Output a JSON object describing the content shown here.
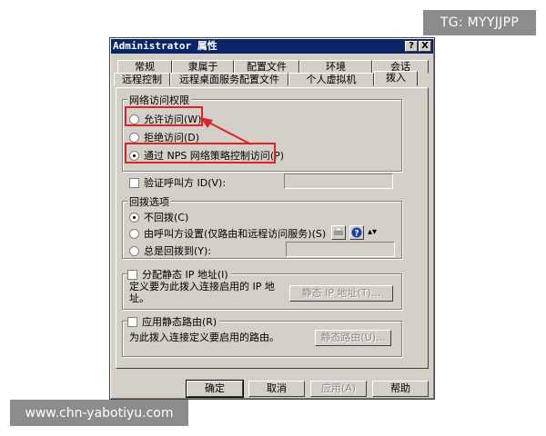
{
  "watermark_top": "TG: MYYJJPP",
  "watermark_bottom": "www.chn-yabotiyu.com",
  "window": {
    "title": "Administrator 属性",
    "help_btn": "?",
    "close_btn": "X"
  },
  "tabs_row1": [
    "常规",
    "隶属于",
    "配置文件",
    "环境",
    "会话"
  ],
  "tabs_row2": [
    "远程控制",
    "远程桌面服务配置文件",
    "个人虚拟机",
    "拨入"
  ],
  "access": {
    "legend": "网络访问权限",
    "allow": "允许访问(W)",
    "deny": "拒绝访问(D)",
    "nps": "通过 NPS 网络策略控制访问(P)"
  },
  "verify_caller_id": "验证呼叫方 ID(V):",
  "callback": {
    "legend": "回拨选项",
    "none": "不回拨(C)",
    "caller": "由呼叫方设置(仅路由和远程访问服务)(S)",
    "always": "总是回拨到(Y):"
  },
  "static_ip": {
    "legend": "分配静态 IP 地址(I)",
    "desc": "定义要为此拨入连接启用的 IP 地址。",
    "button": "静态 IP 地址(T)..."
  },
  "static_routes": {
    "legend": "应用静态路由(R)",
    "desc": "为此拨入连接定义要启用的路由。",
    "button": "静态路由(U)..."
  },
  "footer": {
    "ok": "确定",
    "cancel": "取消",
    "apply": "应用(A)",
    "help": "帮助"
  },
  "colors": {
    "titlebar": "#0a246a",
    "dialog_bg": "#d4d0c8",
    "annotation_red": "#e0202a"
  }
}
